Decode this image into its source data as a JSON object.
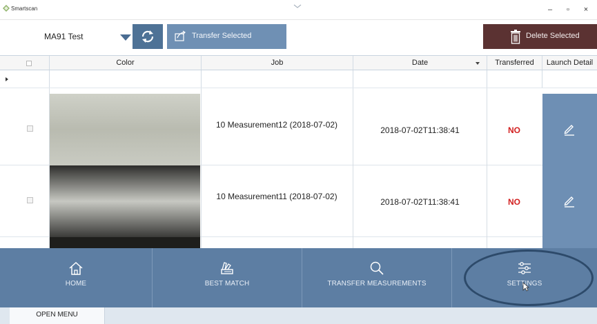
{
  "window": {
    "title": "Smartscan",
    "minimize_glyph": "–",
    "maximize_glyph": "▫",
    "close_glyph": "×"
  },
  "toolbar": {
    "device_value": "MA91 Test",
    "refresh_icon": "refresh-icon",
    "transfer_label": "Transfer Selected",
    "delete_label": "Delete Selected",
    "colors": {
      "refresh": "#4e7296",
      "transfer": "#6f90b4",
      "delete": "#5b3232"
    }
  },
  "table": {
    "columns": [
      "Color",
      "Job",
      "Date",
      "Transferred",
      "Launch Detail"
    ],
    "rows": [
      {
        "job": "10 Measurement12 (2018-07-02)",
        "date": "2018-07-02T11:38:41",
        "transferred": "NO",
        "swatch_colors": [
          "#cfd1c8",
          "#b9bbb0",
          "#c9cbc2"
        ]
      },
      {
        "job": "10 Measurement11 (2018-07-02)",
        "date": "2018-07-02T11:38:41",
        "transferred": "NO",
        "swatch_colors": [
          "#2e2e2c",
          "#c7c8c2",
          "#3a3a38"
        ]
      }
    ],
    "partial_row_swatch": "#1e1e1c",
    "status_color": "#d21f1f"
  },
  "nav": {
    "items": [
      {
        "label": "HOME",
        "icon": "home-icon"
      },
      {
        "label": "BEST MATCH",
        "icon": "fan-deck-icon"
      },
      {
        "label": "TRANSFER MEASUREMENTS",
        "icon": "search-icon"
      },
      {
        "label": "SETTINGS",
        "icon": "sliders-icon"
      }
    ],
    "background": "#5d7ea3"
  },
  "footer": {
    "open_menu_label": "OPEN MENU"
  }
}
